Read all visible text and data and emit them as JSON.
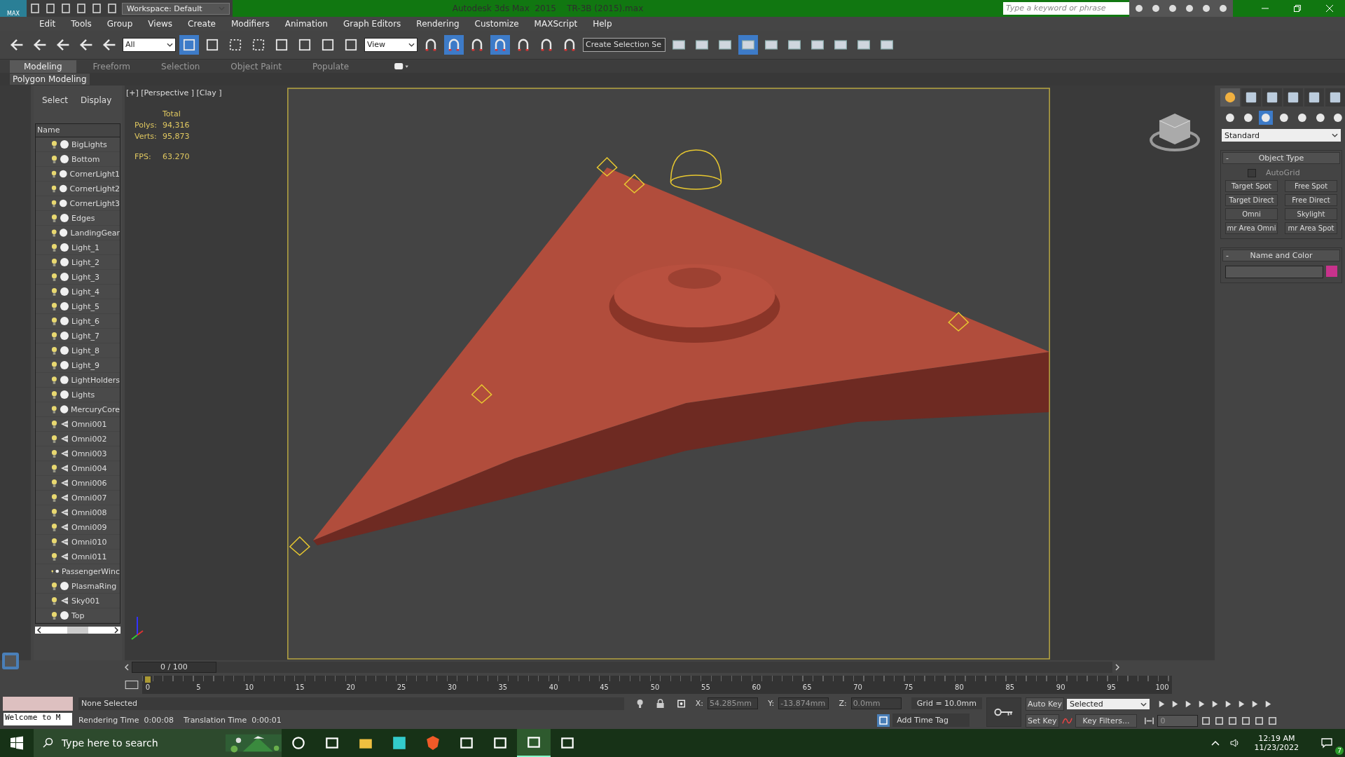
{
  "title_bar": {
    "logo": "MAX",
    "workspace": "Workspace: Default",
    "title": "Autodesk 3ds Max  2015    TR-3B (2015).max",
    "search_placeholder": "Type a keyword or phrase"
  },
  "menu": [
    "Edit",
    "Tools",
    "Group",
    "Views",
    "Create",
    "Modifiers",
    "Animation",
    "Graph Editors",
    "Rendering",
    "Customize",
    "MAXScript",
    "Help"
  ],
  "toolbar": {
    "selection_filter": "All",
    "reference_coord": "View",
    "named_selection": "Create Selection Se"
  },
  "ribbon": {
    "tabs": [
      {
        "label": "Modeling",
        "selected": true
      },
      {
        "label": "Freeform",
        "selected": false
      },
      {
        "label": "Selection",
        "selected": false
      },
      {
        "label": "Object Paint",
        "selected": false
      },
      {
        "label": "Populate",
        "selected": false
      }
    ],
    "panel": "Polygon Modeling"
  },
  "scene_explorer": {
    "tabs": [
      "Select",
      "Display"
    ],
    "column": "Name",
    "items": [
      {
        "name": "BigLights",
        "kind": "geometry"
      },
      {
        "name": "Bottom",
        "kind": "geometry"
      },
      {
        "name": "CornerLight1",
        "kind": "geometry"
      },
      {
        "name": "CornerLight2",
        "kind": "geometry"
      },
      {
        "name": "CornerLight3",
        "kind": "geometry"
      },
      {
        "name": "Edges",
        "kind": "geometry"
      },
      {
        "name": "LandingGear",
        "kind": "geometry"
      },
      {
        "name": "Light_1",
        "kind": "geometry"
      },
      {
        "name": "Light_2",
        "kind": "geometry"
      },
      {
        "name": "Light_3",
        "kind": "geometry"
      },
      {
        "name": "Light_4",
        "kind": "geometry"
      },
      {
        "name": "Light_5",
        "kind": "geometry"
      },
      {
        "name": "Light_6",
        "kind": "geometry"
      },
      {
        "name": "Light_7",
        "kind": "geometry"
      },
      {
        "name": "Light_8",
        "kind": "geometry"
      },
      {
        "name": "Light_9",
        "kind": "geometry"
      },
      {
        "name": "LightHolders",
        "kind": "geometry"
      },
      {
        "name": "Lights",
        "kind": "geometry"
      },
      {
        "name": "MercuryCore",
        "kind": "geometry"
      },
      {
        "name": "Omni001",
        "kind": "light"
      },
      {
        "name": "Omni002",
        "kind": "light"
      },
      {
        "name": "Omni003",
        "kind": "light"
      },
      {
        "name": "Omni004",
        "kind": "light"
      },
      {
        "name": "Omni006",
        "kind": "light"
      },
      {
        "name": "Omni007",
        "kind": "light"
      },
      {
        "name": "Omni008",
        "kind": "light"
      },
      {
        "name": "Omni009",
        "kind": "light"
      },
      {
        "name": "Omni010",
        "kind": "light"
      },
      {
        "name": "Omni011",
        "kind": "light"
      },
      {
        "name": "PassengerWinc",
        "kind": "geometry"
      },
      {
        "name": "PlasmaRing",
        "kind": "geometry"
      },
      {
        "name": "Sky001",
        "kind": "light"
      },
      {
        "name": "Top",
        "kind": "geometry"
      }
    ]
  },
  "viewport": {
    "label": "[+] [Perspective ] [Clay ]",
    "stats_header": "Total",
    "stats": [
      {
        "label": "Polys:",
        "value": "94,316"
      },
      {
        "label": "Verts:",
        "value": "95,873"
      }
    ],
    "fps_label": "FPS:",
    "fps": "63.270"
  },
  "command_panel": {
    "tabs": [
      {
        "selected": true
      },
      {
        "selected": false
      },
      {
        "selected": false
      },
      {
        "selected": false
      },
      {
        "selected": false
      },
      {
        "selected": false
      }
    ],
    "categories": [
      {
        "selected": false
      },
      {
        "selected": false
      },
      {
        "selected": true
      },
      {
        "selected": false
      },
      {
        "selected": false
      },
      {
        "selected": false
      },
      {
        "selected": false
      }
    ],
    "dropdown": "Standard",
    "object_type": {
      "toggle": "-",
      "title": "Object Type",
      "autogrid_label": "AutoGrid",
      "autogrid_checked": false,
      "buttons": [
        "Target Spot",
        "Free Spot",
        "Target Direct",
        "Free Direct",
        "Omni",
        "Skylight",
        "mr Area Omni",
        "mr Area Spot"
      ]
    },
    "name_color": {
      "toggle": "-",
      "title": "Name and Color",
      "color": "#c8328c"
    }
  },
  "time_slider": {
    "position": "0 / 100",
    "level": 0
  },
  "track_bar": {
    "ticks": [
      "0",
      "5",
      "10",
      "15",
      "20",
      "25",
      "30",
      "35",
      "40",
      "45",
      "50",
      "55",
      "60",
      "65",
      "70",
      "75",
      "80",
      "85",
      "90",
      "95",
      "100"
    ]
  },
  "status": {
    "listener": "Welcome to M",
    "selection": "None Selected",
    "prompts": [
      "Rendering Time  0:00:08",
      "Translation Time  0:00:01"
    ],
    "x_label": "X:",
    "x": "54.285mm",
    "y_label": "Y:",
    "y": "-13.874mm",
    "z_label": "Z:",
    "z": "0.0mm",
    "grid": "Grid = 10.0mm",
    "add_time_tag": "Add Time Tag"
  },
  "animation": {
    "auto_key": "Auto Key",
    "set_key": "Set Key",
    "key_mode": "Selected",
    "key_filters": "Key Filters...",
    "frame": "0"
  },
  "taskbar": {
    "search_placeholder": "Type here to search",
    "time": "12:19 AM",
    "date": "11/23/2022",
    "notifications": "7"
  }
}
